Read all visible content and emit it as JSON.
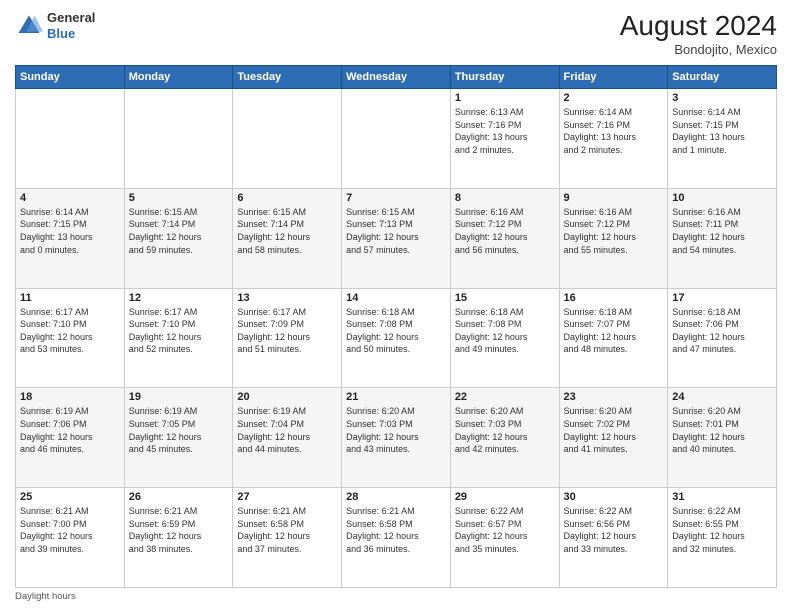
{
  "header": {
    "logo": {
      "general": "General",
      "blue": "Blue"
    },
    "title": "August 2024",
    "location": "Bondojito, Mexico"
  },
  "calendar": {
    "days_of_week": [
      "Sunday",
      "Monday",
      "Tuesday",
      "Wednesday",
      "Thursday",
      "Friday",
      "Saturday"
    ],
    "weeks": [
      [
        {
          "day": "",
          "info": ""
        },
        {
          "day": "",
          "info": ""
        },
        {
          "day": "",
          "info": ""
        },
        {
          "day": "",
          "info": ""
        },
        {
          "day": "1",
          "info": "Sunrise: 6:13 AM\nSunset: 7:16 PM\nDaylight: 13 hours\nand 2 minutes."
        },
        {
          "day": "2",
          "info": "Sunrise: 6:14 AM\nSunset: 7:16 PM\nDaylight: 13 hours\nand 2 minutes."
        },
        {
          "day": "3",
          "info": "Sunrise: 6:14 AM\nSunset: 7:15 PM\nDaylight: 13 hours\nand 1 minute."
        }
      ],
      [
        {
          "day": "4",
          "info": "Sunrise: 6:14 AM\nSunset: 7:15 PM\nDaylight: 13 hours\nand 0 minutes."
        },
        {
          "day": "5",
          "info": "Sunrise: 6:15 AM\nSunset: 7:14 PM\nDaylight: 12 hours\nand 59 minutes."
        },
        {
          "day": "6",
          "info": "Sunrise: 6:15 AM\nSunset: 7:14 PM\nDaylight: 12 hours\nand 58 minutes."
        },
        {
          "day": "7",
          "info": "Sunrise: 6:15 AM\nSunset: 7:13 PM\nDaylight: 12 hours\nand 57 minutes."
        },
        {
          "day": "8",
          "info": "Sunrise: 6:16 AM\nSunset: 7:12 PM\nDaylight: 12 hours\nand 56 minutes."
        },
        {
          "day": "9",
          "info": "Sunrise: 6:16 AM\nSunset: 7:12 PM\nDaylight: 12 hours\nand 55 minutes."
        },
        {
          "day": "10",
          "info": "Sunrise: 6:16 AM\nSunset: 7:11 PM\nDaylight: 12 hours\nand 54 minutes."
        }
      ],
      [
        {
          "day": "11",
          "info": "Sunrise: 6:17 AM\nSunset: 7:10 PM\nDaylight: 12 hours\nand 53 minutes."
        },
        {
          "day": "12",
          "info": "Sunrise: 6:17 AM\nSunset: 7:10 PM\nDaylight: 12 hours\nand 52 minutes."
        },
        {
          "day": "13",
          "info": "Sunrise: 6:17 AM\nSunset: 7:09 PM\nDaylight: 12 hours\nand 51 minutes."
        },
        {
          "day": "14",
          "info": "Sunrise: 6:18 AM\nSunset: 7:08 PM\nDaylight: 12 hours\nand 50 minutes."
        },
        {
          "day": "15",
          "info": "Sunrise: 6:18 AM\nSunset: 7:08 PM\nDaylight: 12 hours\nand 49 minutes."
        },
        {
          "day": "16",
          "info": "Sunrise: 6:18 AM\nSunset: 7:07 PM\nDaylight: 12 hours\nand 48 minutes."
        },
        {
          "day": "17",
          "info": "Sunrise: 6:18 AM\nSunset: 7:06 PM\nDaylight: 12 hours\nand 47 minutes."
        }
      ],
      [
        {
          "day": "18",
          "info": "Sunrise: 6:19 AM\nSunset: 7:06 PM\nDaylight: 12 hours\nand 46 minutes."
        },
        {
          "day": "19",
          "info": "Sunrise: 6:19 AM\nSunset: 7:05 PM\nDaylight: 12 hours\nand 45 minutes."
        },
        {
          "day": "20",
          "info": "Sunrise: 6:19 AM\nSunset: 7:04 PM\nDaylight: 12 hours\nand 44 minutes."
        },
        {
          "day": "21",
          "info": "Sunrise: 6:20 AM\nSunset: 7:03 PM\nDaylight: 12 hours\nand 43 minutes."
        },
        {
          "day": "22",
          "info": "Sunrise: 6:20 AM\nSunset: 7:03 PM\nDaylight: 12 hours\nand 42 minutes."
        },
        {
          "day": "23",
          "info": "Sunrise: 6:20 AM\nSunset: 7:02 PM\nDaylight: 12 hours\nand 41 minutes."
        },
        {
          "day": "24",
          "info": "Sunrise: 6:20 AM\nSunset: 7:01 PM\nDaylight: 12 hours\nand 40 minutes."
        }
      ],
      [
        {
          "day": "25",
          "info": "Sunrise: 6:21 AM\nSunset: 7:00 PM\nDaylight: 12 hours\nand 39 minutes."
        },
        {
          "day": "26",
          "info": "Sunrise: 6:21 AM\nSunset: 6:59 PM\nDaylight: 12 hours\nand 38 minutes."
        },
        {
          "day": "27",
          "info": "Sunrise: 6:21 AM\nSunset: 6:58 PM\nDaylight: 12 hours\nand 37 minutes."
        },
        {
          "day": "28",
          "info": "Sunrise: 6:21 AM\nSunset: 6:58 PM\nDaylight: 12 hours\nand 36 minutes."
        },
        {
          "day": "29",
          "info": "Sunrise: 6:22 AM\nSunset: 6:57 PM\nDaylight: 12 hours\nand 35 minutes."
        },
        {
          "day": "30",
          "info": "Sunrise: 6:22 AM\nSunset: 6:56 PM\nDaylight: 12 hours\nand 33 minutes."
        },
        {
          "day": "31",
          "info": "Sunrise: 6:22 AM\nSunset: 6:55 PM\nDaylight: 12 hours\nand 32 minutes."
        }
      ]
    ],
    "footer": "Daylight hours"
  }
}
